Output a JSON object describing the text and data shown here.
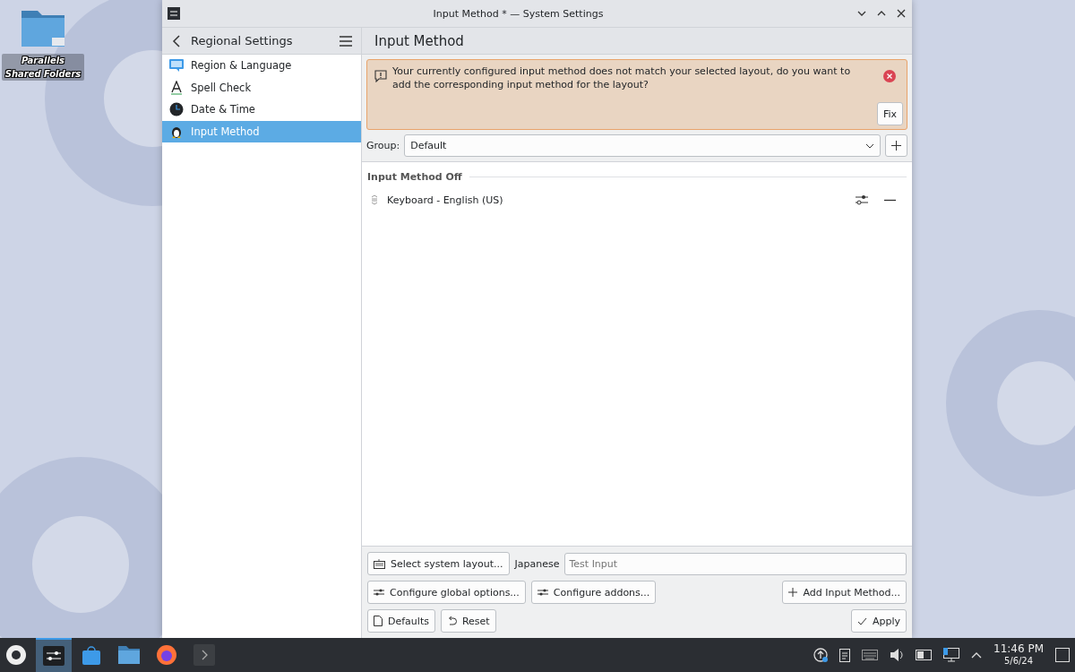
{
  "window": {
    "title": "Input Method * — System Settings"
  },
  "desktop_icons": [
    {
      "label": "Parallels Shared Folders"
    }
  ],
  "sidebar": {
    "title": "Regional Settings",
    "items": [
      {
        "label": "Region & Language",
        "kind": "region",
        "selected": false
      },
      {
        "label": "Spell Check",
        "kind": "spell",
        "selected": false
      },
      {
        "label": "Date & Time",
        "kind": "clock",
        "selected": false
      },
      {
        "label": "Input Method",
        "kind": "penguin",
        "selected": true
      }
    ]
  },
  "page": {
    "title": "Input Method",
    "alert": {
      "message": "Your currently configured input method does not match your selected layout, do you want to add the corresponding input method for the layout?",
      "button": "Fix"
    },
    "group": {
      "label": "Group:",
      "value": "Default"
    },
    "section": "Input Method Off",
    "methods": [
      {
        "label": "Keyboard - English (US)"
      }
    ],
    "footer": {
      "layout_button": "Select system layout...",
      "test_label": "Japanese",
      "test_placeholder": "Test Input",
      "global_button": "Configure global options...",
      "addons_button": "Configure addons...",
      "add_button": "Add Input Method...",
      "defaults_button": "Defaults",
      "reset_button": "Reset",
      "apply_button": "Apply"
    }
  },
  "taskbar": {
    "tasks": [
      {
        "kind": "settings",
        "selected": true
      },
      {
        "kind": "store",
        "selected": false
      },
      {
        "kind": "folder",
        "selected": false
      },
      {
        "kind": "browser",
        "selected": false
      },
      {
        "kind": "terminal",
        "selected": false
      }
    ],
    "time": "11:46 PM",
    "date": "5/6/24"
  }
}
